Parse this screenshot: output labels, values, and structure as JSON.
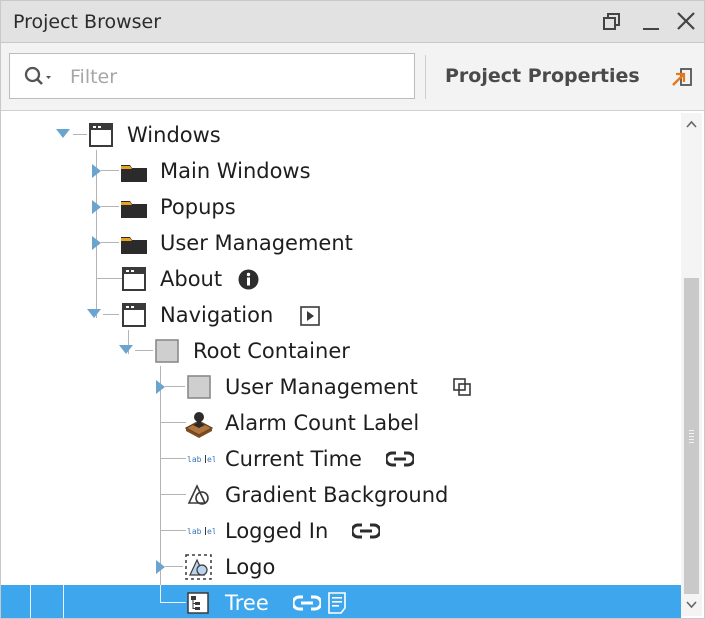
{
  "panel": {
    "title": "Project Browser"
  },
  "toolbar": {
    "filter_placeholder": "Filter",
    "project_properties": "Project Properties"
  },
  "tree": {
    "windows": "Windows",
    "main_windows": "Main Windows",
    "popups": "Popups",
    "user_management_folder": "User Management",
    "about": "About",
    "navigation": "Navigation",
    "root_container": "Root Container",
    "user_management_container": "User Management",
    "alarm_count_label": "Alarm Count Label",
    "current_time": "Current Time",
    "gradient_background": "Gradient Background",
    "logged_in": "Logged In",
    "logo": "Logo",
    "tree": "Tree"
  },
  "colors": {
    "selection": "#3EA6ED",
    "folder": "#2b2b2b",
    "title_bar": "#E2E2E2",
    "project_properties_icon": "#E8771A"
  }
}
